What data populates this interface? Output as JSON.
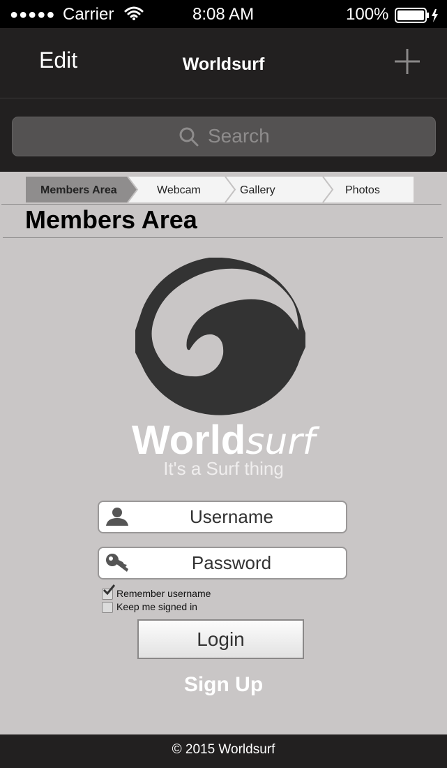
{
  "status_bar": {
    "signal": "●●●●●",
    "carrier": "Carrier",
    "time": "8:08 AM",
    "battery": "100%"
  },
  "nav": {
    "edit_label": "Edit",
    "title": "Worldsurf",
    "add_icon": "plus-icon"
  },
  "search": {
    "placeholder": "Search"
  },
  "breadcrumbs": [
    "Members Area",
    "Webcam",
    "Gallery",
    "Photos"
  ],
  "page": {
    "heading": "Members Area",
    "brand_bold": "World",
    "brand_light": "surf",
    "tagline": "It's a Surf thing"
  },
  "login_form": {
    "username_placeholder": "Username",
    "password_placeholder": "Password",
    "remember_label": "Remember username",
    "remember_checked": true,
    "keep_signed_label": "Keep me signed in",
    "keep_signed_checked": false,
    "login_label": "Login",
    "signup_label": "Sign Up"
  },
  "footer": {
    "text": "© 2015 Worldsurf"
  }
}
